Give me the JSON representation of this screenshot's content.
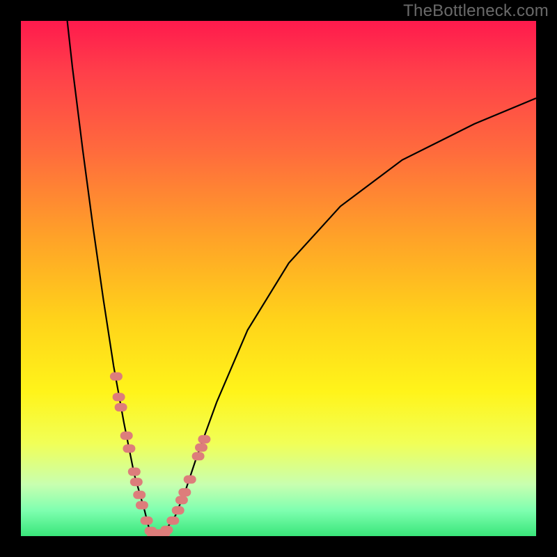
{
  "watermark": "TheBottleneck.com",
  "chart_data": {
    "type": "line",
    "title": "",
    "xlabel": "",
    "ylabel": "",
    "xlim": [
      0,
      100
    ],
    "ylim": [
      0,
      100
    ],
    "series": [
      {
        "name": "bottleneck-curve",
        "x": [
          9,
          10,
          12,
          14,
          16,
          18,
          20,
          22,
          24,
          25,
          26,
          27,
          28,
          30,
          32,
          34,
          38,
          44,
          52,
          62,
          74,
          88,
          100
        ],
        "values": [
          100,
          91,
          75,
          60,
          46,
          33,
          22,
          12,
          5,
          1,
          0,
          0,
          1,
          4,
          9,
          15,
          26,
          40,
          53,
          64,
          73,
          80,
          85
        ]
      }
    ],
    "markers": {
      "name": "highlight-dots",
      "color": "#dd7d7b",
      "points": [
        {
          "x": 18.5,
          "y": 31
        },
        {
          "x": 19.0,
          "y": 27
        },
        {
          "x": 19.4,
          "y": 25
        },
        {
          "x": 20.5,
          "y": 19.5
        },
        {
          "x": 21.0,
          "y": 17
        },
        {
          "x": 22.0,
          "y": 12.5
        },
        {
          "x": 22.4,
          "y": 10.5
        },
        {
          "x": 23.0,
          "y": 8
        },
        {
          "x": 23.5,
          "y": 6
        },
        {
          "x": 24.4,
          "y": 3
        },
        {
          "x": 25.2,
          "y": 1
        },
        {
          "x": 25.6,
          "y": 0.5
        },
        {
          "x": 27.0,
          "y": 0.5
        },
        {
          "x": 27.8,
          "y": 0.6
        },
        {
          "x": 28.3,
          "y": 1.2
        },
        {
          "x": 29.5,
          "y": 3
        },
        {
          "x": 30.5,
          "y": 5
        },
        {
          "x": 31.2,
          "y": 7
        },
        {
          "x": 31.8,
          "y": 8.5
        },
        {
          "x": 32.8,
          "y": 11
        },
        {
          "x": 34.4,
          "y": 15.5
        },
        {
          "x": 35.0,
          "y": 17.2
        },
        {
          "x": 35.6,
          "y": 18.8
        }
      ]
    }
  }
}
